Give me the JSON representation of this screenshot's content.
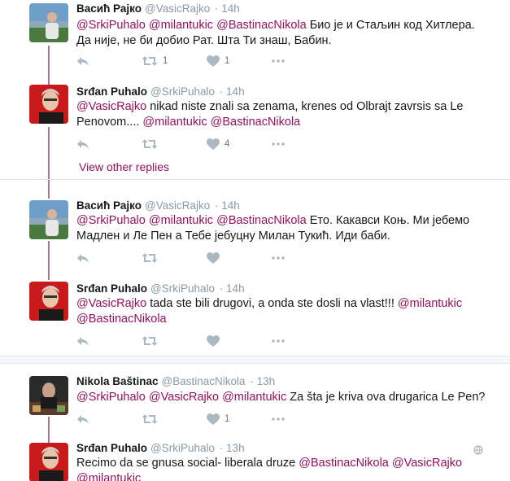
{
  "colors": {
    "accent": "#94105e",
    "thread_line": "#b4729b",
    "muted": "#8899a6"
  },
  "view_other_replies": "View other replies",
  "tweets": [
    {
      "fullname": "Васић Рајко",
      "handle": "@VasicRajko",
      "separator": "·",
      "time": "14h",
      "text": [
        {
          "m": "@SrkiPuhalo"
        },
        {
          "t": " "
        },
        {
          "m": "@milantukic"
        },
        {
          "t": " "
        },
        {
          "m": "@BastinacNikola"
        },
        {
          "t": " Био је и Стаљин код Хитлера. Да није, не би добио Рат. Шта Ти знаш, Бабин."
        }
      ],
      "reply_count": "",
      "retweet_count": "1",
      "like_count": "1"
    },
    {
      "fullname": "Srđan Puhalo",
      "handle": "@SrkiPuhalo",
      "separator": "·",
      "time": "14h",
      "text": [
        {
          "m": "@VasicRajko"
        },
        {
          "t": " nikad niste znali sa zenama, krenes od Olbrajt zavrsis sa Le Penovom....  "
        },
        {
          "m": "@milantukic"
        },
        {
          "t": " "
        },
        {
          "m": "@BastinacNikola"
        }
      ],
      "reply_count": "",
      "retweet_count": "",
      "like_count": "4"
    },
    {
      "fullname": "Васић Рајко",
      "handle": "@VasicRajko",
      "separator": "·",
      "time": "14h",
      "text": [
        {
          "m": "@SrkiPuhalo"
        },
        {
          "t": " "
        },
        {
          "m": "@milantukic"
        },
        {
          "t": " "
        },
        {
          "m": "@BastinacNikola"
        },
        {
          "t": " Ето. Какавси Коњ. Ми јебемо Мадлен и Ле Пен а Тебе јебуцну Милан Тукић. Иди баби."
        }
      ],
      "reply_count": "",
      "retweet_count": "",
      "like_count": ""
    },
    {
      "fullname": "Srđan Puhalo",
      "handle": "@SrkiPuhalo",
      "separator": "·",
      "time": "14h",
      "text": [
        {
          "m": "@VasicRajko"
        },
        {
          "t": " tada ste bili drugovi, a onda ste dosli na vlast!!! "
        },
        {
          "m": "@milantukic"
        },
        {
          "t": " "
        },
        {
          "m": "@BastinacNikola"
        }
      ],
      "reply_count": "",
      "retweet_count": "",
      "like_count": ""
    },
    {
      "fullname": "Nikola Baštinac",
      "handle": "@BastinacNikola",
      "separator": "·",
      "time": "13h",
      "text": [
        {
          "m": "@SrkiPuhalo"
        },
        {
          "t": " "
        },
        {
          "m": "@VasicRajko"
        },
        {
          "t": " "
        },
        {
          "m": "@milantukic"
        },
        {
          "t": " Za šta je kriva ova drugarica Le Pen?"
        }
      ],
      "reply_count": "",
      "retweet_count": "",
      "like_count": "1"
    },
    {
      "fullname": "Srđan Puhalo",
      "handle": "@SrkiPuhalo",
      "separator": "·",
      "time": "13h",
      "text": [
        {
          "t": "Recimo da se gnusa social- liberala druze "
        },
        {
          "m": "@BastinacNikola"
        },
        {
          "t": " "
        },
        {
          "m": "@VasicRajko"
        },
        {
          "t": " "
        },
        {
          "m": "@milantukic"
        }
      ],
      "reply_count": "",
      "retweet_count": "",
      "like_count": ""
    }
  ]
}
